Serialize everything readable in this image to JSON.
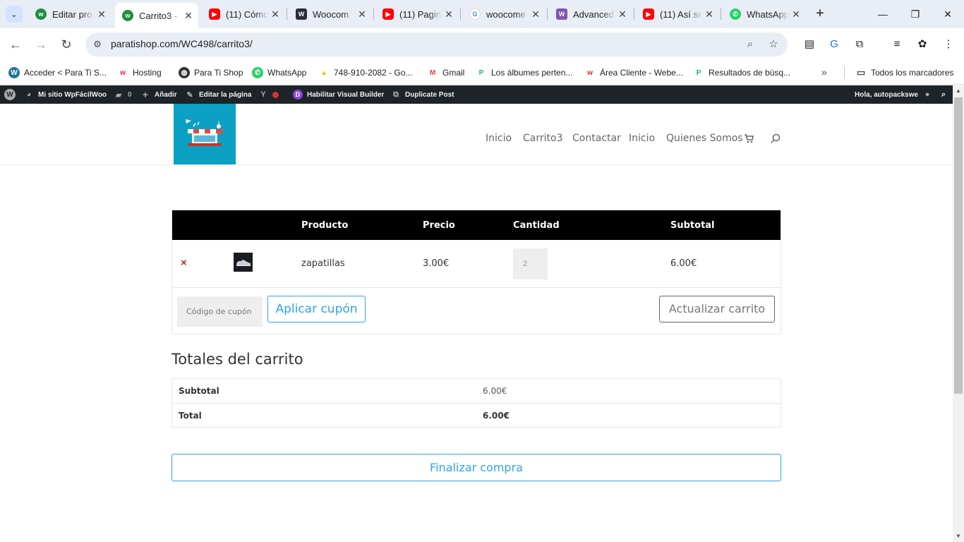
{
  "browser": {
    "tabs": [
      {
        "title": "Editar pro",
        "favicon": "webempresa-icon",
        "active": false
      },
      {
        "title": "Carrito3 -",
        "favicon": "webempresa-icon",
        "active": true
      },
      {
        "title": "(11) Cómo",
        "favicon": "youtube-icon",
        "active": false
      },
      {
        "title": "Woocom",
        "favicon": "woo-icon",
        "active": false
      },
      {
        "title": "(11) Pagin",
        "favicon": "youtube-icon",
        "active": false
      },
      {
        "title": "woocome",
        "favicon": "google-icon",
        "active": false
      },
      {
        "title": "Advanced",
        "favicon": "woo-purple-icon",
        "active": false
      },
      {
        "title": "(11) Así se",
        "favicon": "youtube-icon",
        "active": false
      },
      {
        "title": "WhatsApp",
        "favicon": "whatsapp-icon",
        "active": false
      }
    ],
    "url": "paratishop.com/WC498/carrito3/",
    "bookmarks": [
      {
        "label": "Acceder < Para Ti S...",
        "icon": "wordpress-icon"
      },
      {
        "label": "Hosting",
        "icon": "webempresa-icon"
      },
      {
        "label": "Para Ti Shop",
        "icon": "globe-icon"
      },
      {
        "label": "WhatsApp",
        "icon": "whatsapp-icon"
      },
      {
        "label": "748-910-2082 - Go...",
        "icon": "google-ads-icon"
      },
      {
        "label": "Gmail",
        "icon": "gmail-icon"
      },
      {
        "label": "Los álbumes perten...",
        "icon": "picsart-icon"
      },
      {
        "label": "Área Cliente - Webe...",
        "icon": "webempresa-icon"
      },
      {
        "label": "Resultados de búsq...",
        "icon": "picsart-icon"
      }
    ],
    "all_bookmarks": "Todos los marcadores"
  },
  "wp_admin_bar": {
    "site": "Mi sitio WpFácilWoo",
    "comments": "0",
    "add": "Añadir",
    "edit": "Editar la página",
    "visual_builder": "Habilitar Visual Builder",
    "duplicate": "Duplicate Post",
    "greeting": "Hola, autopackswe"
  },
  "site": {
    "nav": [
      "Inicio",
      "Carrito3",
      "Contactar",
      "Inicio",
      "Quienes Somos"
    ]
  },
  "cart": {
    "headers": {
      "product": "Producto",
      "price": "Precio",
      "quantity": "Cantidad",
      "subtotal": "Subtotal"
    },
    "items": [
      {
        "name": "zapatillas",
        "price": "3.00€",
        "quantity": "2",
        "subtotal": "6.00€"
      }
    ],
    "coupon_placeholder": "Código de cupón",
    "apply_coupon": "Aplicar cupón",
    "update_cart": "Actualizar carrito"
  },
  "totals": {
    "title": "Totales del carrito",
    "subtotal_label": "Subtotal",
    "subtotal_value": "6.00€",
    "total_label": "Total",
    "total_value": "6.00€",
    "checkout": "Finalizar compra"
  },
  "colors": {
    "accent": "#2ea3f2",
    "logo_bg": "#0ca0c4",
    "wp_bar": "#1d2327",
    "remove": "#c81e1e"
  }
}
